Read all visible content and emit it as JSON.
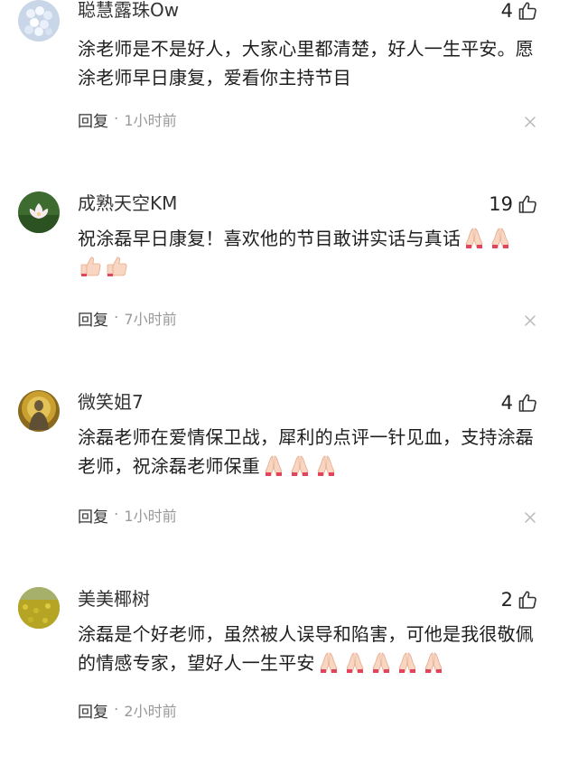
{
  "comments": [
    {
      "username": "聪慧露珠Ow",
      "likes": "4",
      "text": "涂老师是不是好人，大家心里都清楚，好人一生平安。愿涂老师早日康复，爱看你主持节目",
      "emoji": [],
      "reply_label": "回复",
      "separator": "·",
      "time": "1小时前",
      "avatar": "hydrangea-flower-avatar"
    },
    {
      "username": "成熟天空KM",
      "likes": "19",
      "text": "祝涂磊早日康复！喜欢他的节目敢讲实话与真话",
      "emoji": [
        "praying-hands",
        "praying-hands",
        "thumbs-up",
        "thumbs-up"
      ],
      "reply_label": "回复",
      "separator": "·",
      "time": "7小时前",
      "avatar": "lotus-avatar"
    },
    {
      "username": "微笑姐7",
      "likes": "4",
      "text": "涂磊老师在爱情保卫战，犀利的点评一针见血，支持涂磊老师，祝涂磊老师保重",
      "emoji": [
        "praying-hands",
        "praying-hands",
        "praying-hands"
      ],
      "reply_label": "回复",
      "separator": "·",
      "time": "1小时前",
      "avatar": "buddha-avatar"
    },
    {
      "username": "美美椰树",
      "likes": "2",
      "text": "涂磊是个好老师，虽然被人误导和陷害，可他是我很敬佩的情感专家，望好人一生平安",
      "emoji": [
        "praying-hands",
        "praying-hands",
        "praying-hands",
        "praying-hands",
        "praying-hands"
      ],
      "reply_label": "回复",
      "separator": "·",
      "time": "2小时前",
      "avatar": "rapeseed-field-avatar"
    }
  ],
  "colors": {
    "text": "#1e1e1e",
    "muted": "#999999",
    "background": "#ffffff"
  }
}
